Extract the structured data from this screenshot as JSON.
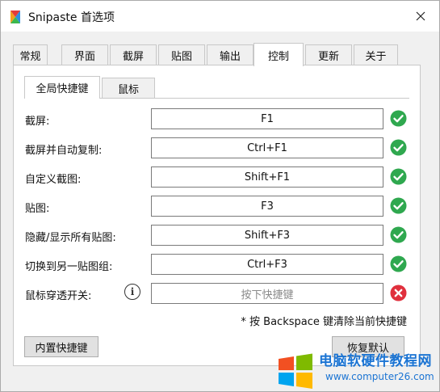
{
  "window": {
    "title": "Snipaste 首选项"
  },
  "tabs": [
    {
      "label": "常规"
    },
    {
      "label": "界面"
    },
    {
      "label": "截屏"
    },
    {
      "label": "贴图"
    },
    {
      "label": "输出"
    },
    {
      "label": "控制"
    },
    {
      "label": "更新"
    },
    {
      "label": "关于"
    }
  ],
  "active_tab": "控制",
  "subtabs": [
    {
      "label": "全局快捷键"
    },
    {
      "label": "鼠标"
    }
  ],
  "active_subtab": "全局快捷键",
  "hotkeys": [
    {
      "label": "截屏:",
      "value": "F1",
      "status": "ok"
    },
    {
      "label": "截屏并自动复制:",
      "value": "Ctrl+F1",
      "status": "ok"
    },
    {
      "label": "自定义截图:",
      "value": "Shift+F1",
      "status": "ok"
    },
    {
      "label": "贴图:",
      "value": "F3",
      "status": "ok"
    },
    {
      "label": "隐藏/显示所有贴图:",
      "value": "Shift+F3",
      "status": "ok"
    },
    {
      "label": "切换到另一贴图组:",
      "value": "Ctrl+F3",
      "status": "ok"
    },
    {
      "label": "鼠标穿透开关:",
      "value": "",
      "placeholder": "按下快捷键",
      "status": "error"
    }
  ],
  "hint": "* 按 Backspace 键清除当前快捷键",
  "buttons": {
    "builtin": "内置快捷键",
    "restore": "恢复默认"
  },
  "colors": {
    "ok": "#2fa84f",
    "error": "#e0303d",
    "watermark": "#1b74d3"
  },
  "watermark": {
    "title": "电脑软硬件教程网",
    "url": "www.computer26.com"
  }
}
